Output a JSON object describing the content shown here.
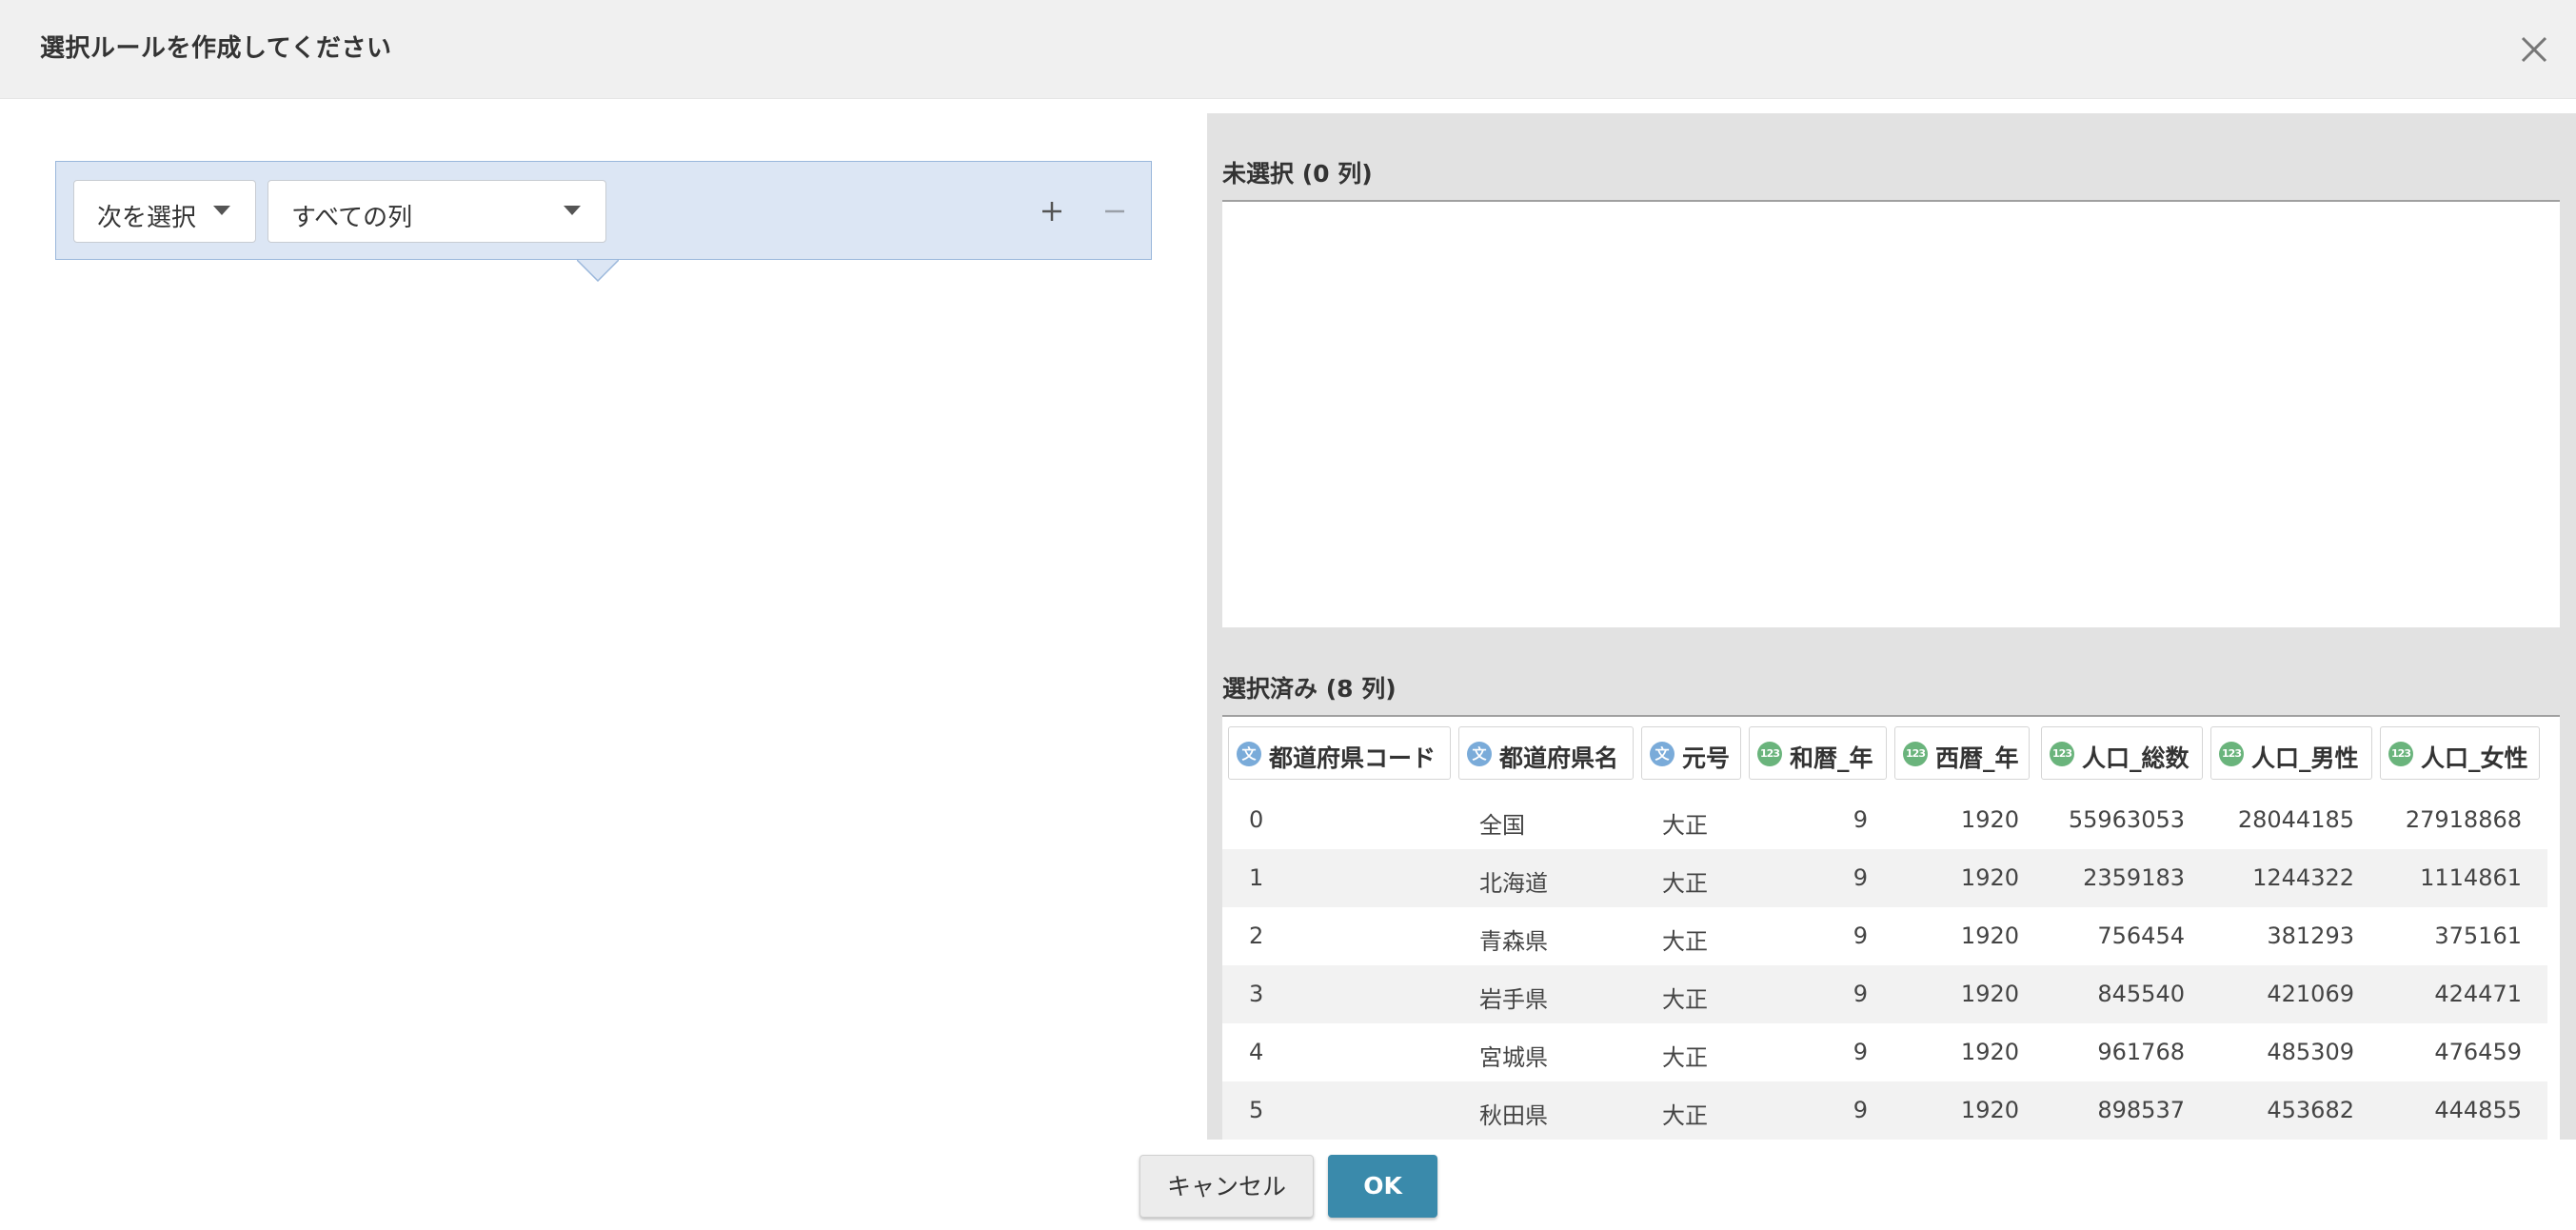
{
  "dialog": {
    "title": "選択ルールを作成してください",
    "close_icon": "close-icon"
  },
  "rule": {
    "mode": "次を選択",
    "target": "すべての列",
    "add_icon": "plus-icon",
    "remove_icon": "minus-icon"
  },
  "unselected": {
    "title": "未選択 (0 列)"
  },
  "selected": {
    "title": "選択済み (8 列)",
    "columns": [
      {
        "label": "都道府県コード",
        "type": "文",
        "type_icon": "string-type-icon"
      },
      {
        "label": "都道府県名",
        "type": "文",
        "type_icon": "string-type-icon"
      },
      {
        "label": "元号",
        "type": "文",
        "type_icon": "string-type-icon"
      },
      {
        "label": "和暦_年",
        "type": "123",
        "type_icon": "number-type-icon"
      },
      {
        "label": "西暦_年",
        "type": "123",
        "type_icon": "number-type-icon"
      },
      {
        "label": "人口_総数",
        "type": "123",
        "type_icon": "number-type-icon"
      },
      {
        "label": "人口_男性",
        "type": "123",
        "type_icon": "number-type-icon"
      },
      {
        "label": "人口_女性",
        "type": "123",
        "type_icon": "number-type-icon"
      }
    ],
    "rows": [
      [
        "0",
        "全国",
        "大正",
        "9",
        "1920",
        "55963053",
        "28044185",
        "27918868"
      ],
      [
        "1",
        "北海道",
        "大正",
        "9",
        "1920",
        "2359183",
        "1244322",
        "1114861"
      ],
      [
        "2",
        "青森県",
        "大正",
        "9",
        "1920",
        "756454",
        "381293",
        "375161"
      ],
      [
        "3",
        "岩手県",
        "大正",
        "9",
        "1920",
        "845540",
        "421069",
        "424471"
      ],
      [
        "4",
        "宮城県",
        "大正",
        "9",
        "1920",
        "961768",
        "485309",
        "476459"
      ],
      [
        "5",
        "秋田県",
        "大正",
        "9",
        "1920",
        "898537",
        "453682",
        "444855"
      ]
    ]
  },
  "footer": {
    "cancel_label": "キャンセル",
    "ok_label": "OK"
  },
  "colors": {
    "header_bg": "#f0f0f0",
    "rule_bg": "#dce6f4",
    "rule_border": "#9ab7db",
    "panel_bg": "#e2e2e2",
    "string_type": "#7aabd9",
    "number_type": "#6ab47c",
    "ok_button": "#3a8aab"
  }
}
